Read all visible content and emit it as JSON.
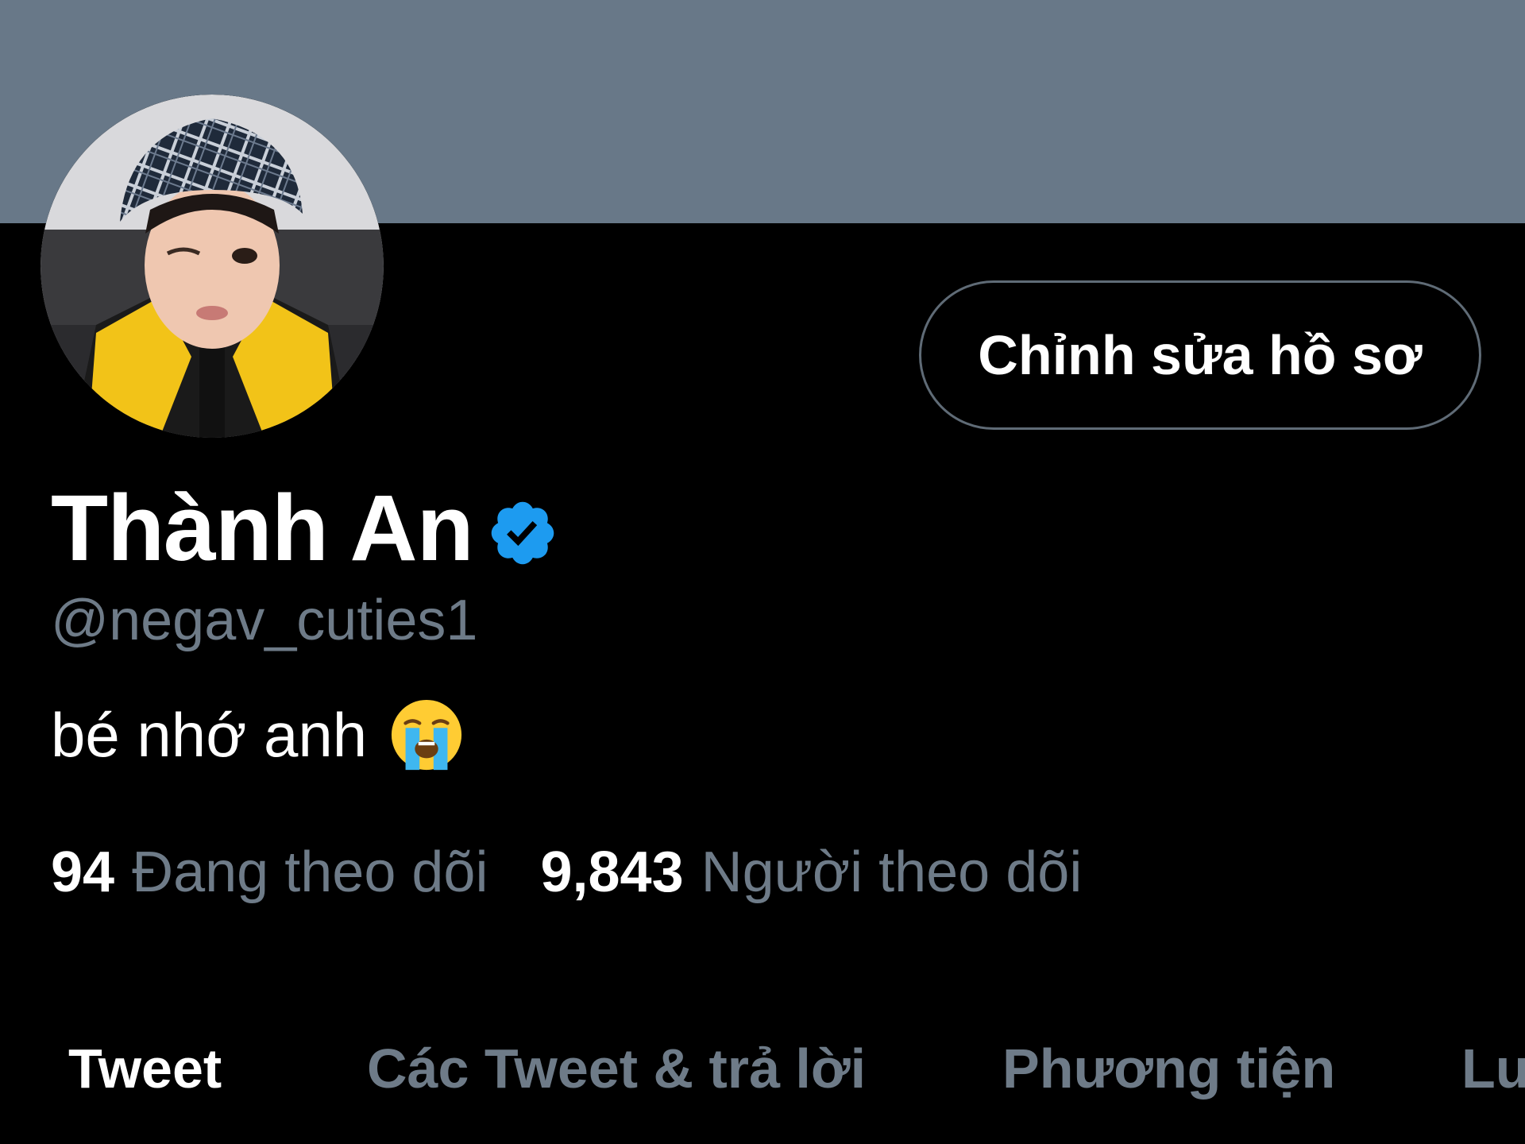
{
  "profile": {
    "display_name": "Thành An",
    "handle": "@negav_cuties1",
    "bio": "bé nhớ anh",
    "bio_emoji": "loudly-crying-face-emoji",
    "verified": true
  },
  "actions": {
    "edit_profile_label": "Chỉnh sửa hồ sơ"
  },
  "stats": {
    "following_count": "94",
    "following_label": "Đang theo dõi",
    "followers_count": "9,843",
    "followers_label": "Người theo dõi"
  },
  "tabs": [
    {
      "label": "Tweet",
      "active": true
    },
    {
      "label": "Các Tweet & trả lời",
      "active": false
    },
    {
      "label": "Phương tiện",
      "active": false
    },
    {
      "label": "Lư",
      "active": false
    }
  ],
  "colors": {
    "background": "#000000",
    "banner": "#687888",
    "secondary_text": "#6e7b88",
    "verified_blue": "#1d9bf0",
    "button_border": "#5f6b76"
  }
}
